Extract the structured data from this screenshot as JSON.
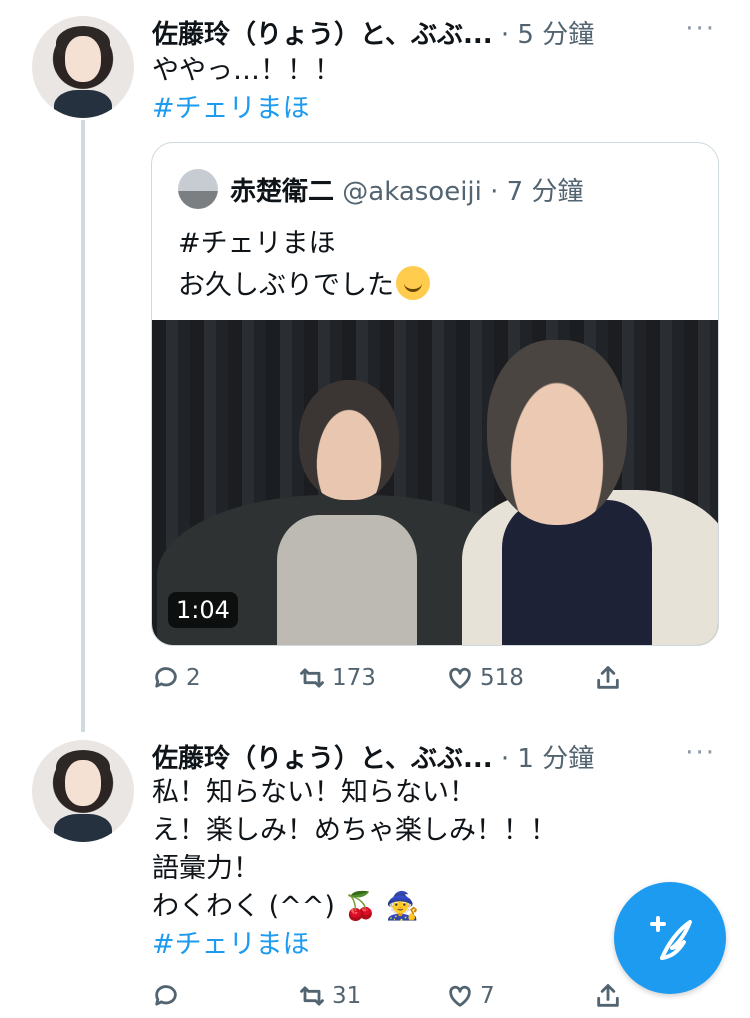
{
  "tweet1": {
    "author": "佐藤玲（りょう）と、ぶぶ...",
    "time": "· 5 分鐘",
    "more": "···",
    "text_line1": "ややっ…！！！",
    "hashtag": "#チェリまほ"
  },
  "quote": {
    "name": "赤楚衛二",
    "handle": "@akasoeiji",
    "time": "· 7 分鐘",
    "hashtag": "#チェリまほ",
    "text_line2": "お久しぶりでした",
    "emoji_icon": "smiling-face-icon",
    "video_duration": "1:04"
  },
  "actions1": {
    "replies": "2",
    "retweets": "173",
    "likes": "518"
  },
  "tweet2": {
    "author": "佐藤玲（りょう）と、ぶぶ...",
    "time": "· 1 分鐘",
    "more": "···",
    "lines": [
      "私！知らない！知らない！",
      "え！楽しみ！めちゃ楽しみ！！！",
      "語彙力！",
      "わくわく (^^)"
    ],
    "emoji1": "🍒",
    "emoji2": "🧙",
    "hashtag": "#チェリまほ"
  },
  "actions2": {
    "replies": "",
    "retweets": "31",
    "likes": "7"
  },
  "colors": {
    "link": "#1d9bf0",
    "muted": "#536471",
    "border": "#cfd9de"
  }
}
